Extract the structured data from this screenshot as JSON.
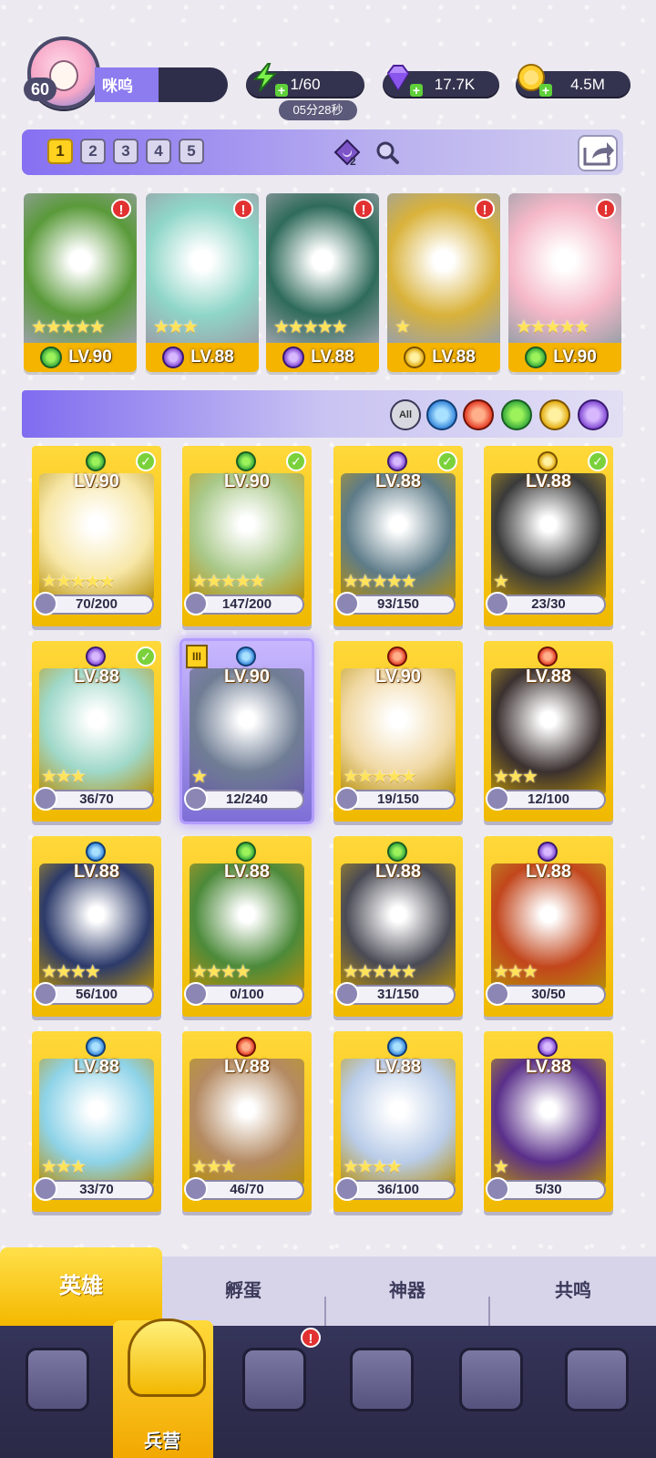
{
  "player": {
    "level": "60",
    "name": "咪呜"
  },
  "resources": {
    "energy": {
      "value": "1/60",
      "icon": "lightning-icon",
      "timer": "05分28秒"
    },
    "gems": {
      "value": "17.7K",
      "icon": "gem-icon"
    },
    "coins": {
      "value": "4.5M",
      "icon": "coin-icon"
    }
  },
  "team_tabs": [
    "1",
    "2",
    "3",
    "4",
    "5"
  ],
  "team_active": "1",
  "team_badge_count": "2",
  "team_cards": [
    {
      "level": "LV.90",
      "element": "nature",
      "color": "#5a9a3a",
      "stars": "★★★★★",
      "alert": "!"
    },
    {
      "level": "LV.88",
      "element": "dark",
      "color": "#8fd6c8",
      "stars": "★★★",
      "alert": "!"
    },
    {
      "level": "LV.88",
      "element": "dark",
      "color": "#2f6b5a",
      "stars": "★★★★★",
      "alert": "!"
    },
    {
      "level": "LV.88",
      "element": "light",
      "color": "#d9b23a",
      "stars": "★",
      "alert": "!"
    },
    {
      "level": "LV.90",
      "element": "nature",
      "color": "#f5b8c8",
      "stars": "★★★★★",
      "alert": "!"
    }
  ],
  "filter": {
    "all_label": "All",
    "elements": [
      "water-element-icon",
      "fire-element-icon",
      "nature-element-icon",
      "light-element-icon",
      "dark-element-icon"
    ]
  },
  "heroes": [
    {
      "level": "LV.90",
      "element": "nature",
      "fragments": "70/200",
      "stars": "★★★★★",
      "checked": true,
      "color": "#f7e7a8"
    },
    {
      "level": "LV.90",
      "element": "nature",
      "fragments": "147/200",
      "stars": "★★★★★",
      "checked": true,
      "color": "#a9c98a"
    },
    {
      "level": "LV.88",
      "element": "dark",
      "fragments": "93/150",
      "stars": "★★★★★",
      "checked": true,
      "color": "#5d7b88"
    },
    {
      "level": "LV.88",
      "element": "light",
      "fragments": "23/30",
      "stars": "★",
      "checked": true,
      "color": "#3a3a3a"
    },
    {
      "level": "LV.88",
      "element": "dark",
      "fragments": "36/70",
      "stars": "★★★",
      "checked": true,
      "color": "#9fd8c8"
    },
    {
      "level": "LV.90",
      "element": "water",
      "fragments": "12/240",
      "stars": "★",
      "checked": false,
      "color": "#6f7d94",
      "rank": "III",
      "selected": true
    },
    {
      "level": "LV.90",
      "element": "fire",
      "fragments": "19/150",
      "stars": "★★★★★",
      "checked": false,
      "color": "#f1d9a6"
    },
    {
      "level": "LV.88",
      "element": "fire",
      "fragments": "12/100",
      "stars": "★★★",
      "checked": false,
      "color": "#3b3130"
    },
    {
      "level": "LV.88",
      "element": "water",
      "fragments": "56/100",
      "stars": "★★★★",
      "checked": false,
      "color": "#2c3a6a"
    },
    {
      "level": "LV.88",
      "element": "nature",
      "fragments": "0/100",
      "stars": "★★★★",
      "checked": false,
      "color": "#4c8a3a"
    },
    {
      "level": "LV.88",
      "element": "nature",
      "fragments": "31/150",
      "stars": "★★★★★",
      "checked": false,
      "color": "#4a4a55"
    },
    {
      "level": "LV.88",
      "element": "dark",
      "fragments": "30/50",
      "stars": "★★★",
      "checked": false,
      "color": "#c2461c"
    },
    {
      "level": "LV.88",
      "element": "water",
      "fragments": "33/70",
      "stars": "★★★",
      "checked": false,
      "color": "#8ed3e8"
    },
    {
      "level": "LV.88",
      "element": "fire",
      "fragments": "46/70",
      "stars": "★★★",
      "checked": false,
      "color": "#b48a62"
    },
    {
      "level": "LV.88",
      "element": "water",
      "fragments": "36/100",
      "stars": "★★★★",
      "checked": false,
      "color": "#b9cce8"
    },
    {
      "level": "LV.88",
      "element": "dark",
      "fragments": "5/30",
      "stars": "★",
      "checked": false,
      "color": "#5a2f8a"
    }
  ],
  "subtabs": [
    {
      "label": "英雄",
      "active": true
    },
    {
      "label": "孵蛋",
      "active": false
    },
    {
      "label": "神器",
      "active": false
    },
    {
      "label": "共鸣",
      "active": false
    }
  ],
  "nav": [
    {
      "label": "",
      "icon": "cards-icon"
    },
    {
      "label": "兵营",
      "icon": "barracks-icon",
      "active": true
    },
    {
      "label": "",
      "icon": "book-icon",
      "alert": "!"
    },
    {
      "label": "",
      "icon": "castle-icon"
    },
    {
      "label": "",
      "icon": "mushroom-house-icon"
    },
    {
      "label": "",
      "icon": "banner-icon"
    }
  ],
  "colors": {
    "accent": "#8670f2",
    "gold": "#f4b800",
    "nav": "#2f2e4a"
  }
}
